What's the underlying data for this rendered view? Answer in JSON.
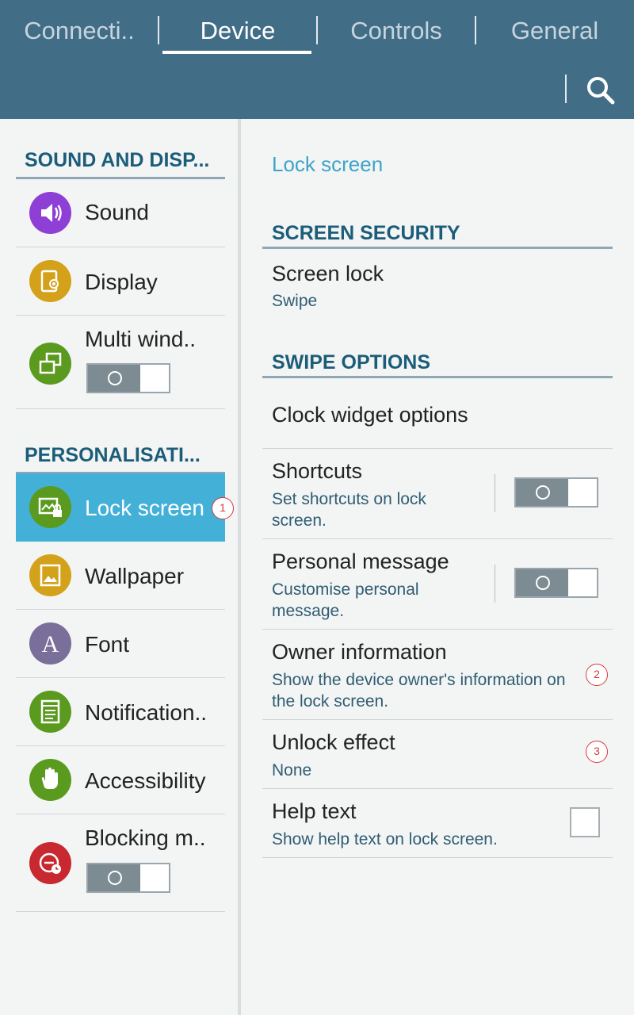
{
  "tabs": [
    {
      "label": "Connecti..",
      "active": false
    },
    {
      "label": "Device",
      "active": true
    },
    {
      "label": "Controls",
      "active": false
    },
    {
      "label": "General",
      "active": false
    }
  ],
  "header": {
    "search_icon": "search-icon"
  },
  "sidebar": {
    "sound_and_display_header": "SOUND AND DISP...",
    "personalisation_header": "PERSONALISATI...",
    "items": [
      {
        "label": "Sound",
        "icon": "speaker-icon",
        "color": "#8e3fd6"
      },
      {
        "label": "Display",
        "icon": "display-icon",
        "color": "#d3a21a"
      },
      {
        "label": "Multi wind..",
        "icon": "multi-window-icon",
        "color": "#5a9a1e",
        "toggle": "off"
      },
      {
        "label": "Lock screen",
        "icon": "lock-screen-icon",
        "color": "#5a9a1e",
        "selected": true
      },
      {
        "label": "Wallpaper",
        "icon": "wallpaper-icon",
        "color": "#d3a21a"
      },
      {
        "label": "Font",
        "icon": "font-icon",
        "color": "#7a6e9a"
      },
      {
        "label": "Notification..",
        "icon": "notification-icon",
        "color": "#5a9a1e"
      },
      {
        "label": "Accessibility",
        "icon": "hand-icon",
        "color": "#5a9a1e"
      },
      {
        "label": "Blocking m..",
        "icon": "blocking-mode-icon",
        "color": "#c8282f",
        "toggle": "off"
      }
    ]
  },
  "main": {
    "breadcrumb": "Lock screen",
    "screen_security_header": "SCREEN SECURITY",
    "screen_lock": {
      "title": "Screen lock",
      "value": "Swipe"
    },
    "swipe_options_header": "SWIPE OPTIONS",
    "clock_widget": {
      "title": "Clock widget options"
    },
    "shortcuts": {
      "title": "Shortcuts",
      "subtitle": "Set shortcuts on lock screen.",
      "toggle": "off"
    },
    "personal_message": {
      "title": "Personal message",
      "subtitle": "Customise personal message.",
      "toggle": "off"
    },
    "owner_information": {
      "title": "Owner information",
      "subtitle": "Show the device owner's information on the lock screen."
    },
    "unlock_effect": {
      "title": "Unlock effect",
      "value": "None"
    },
    "help_text": {
      "title": "Help text",
      "subtitle": "Show help text on lock screen.",
      "checked": false
    }
  },
  "markers": [
    "1",
    "2",
    "3"
  ],
  "colors": {
    "header_bg": "#426d87",
    "accent": "#43b0d8",
    "section_header": "#1b5d79",
    "subtitle": "#2f5d73",
    "marker": "#d63b3b"
  }
}
